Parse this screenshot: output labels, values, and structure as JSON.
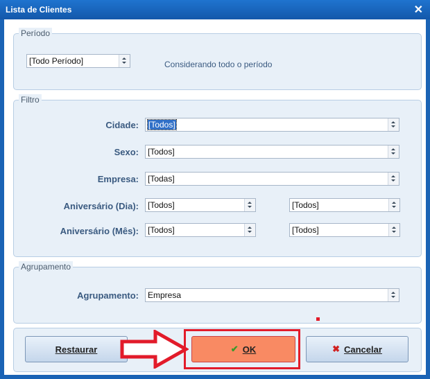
{
  "window": {
    "title": "Lista de Clientes"
  },
  "periodo": {
    "legend": "Período",
    "select_value": "[Todo Período]",
    "description": "Considerando todo o período"
  },
  "filtro": {
    "legend": "Filtro",
    "cidade": {
      "label": "Cidade:",
      "value": "[Todos]"
    },
    "sexo": {
      "label": "Sexo:",
      "value": "[Todos]"
    },
    "empresa": {
      "label": "Empresa:",
      "value": "[Todas]"
    },
    "aniversario_dia": {
      "label": "Aniversário (Dia):",
      "from": "[Todos]",
      "to": "[Todos]"
    },
    "aniversario_mes": {
      "label": "Aniversário (Mês):",
      "from": "[Todos]",
      "to": "[Todos]"
    }
  },
  "agrupamento": {
    "legend": "Agrupamento",
    "label": "Agrupamento:",
    "value": "Empresa"
  },
  "buttons": {
    "restaurar": "Restaurar",
    "ok": "OK",
    "cancelar": "Cancelar"
  },
  "colors": {
    "accent": "#1a63b5",
    "highlight": "#e21b2a",
    "ok_button": "#f98a63"
  },
  "icons": {
    "ok": "check-icon",
    "cancel": "x-icon",
    "close": "close-icon"
  }
}
